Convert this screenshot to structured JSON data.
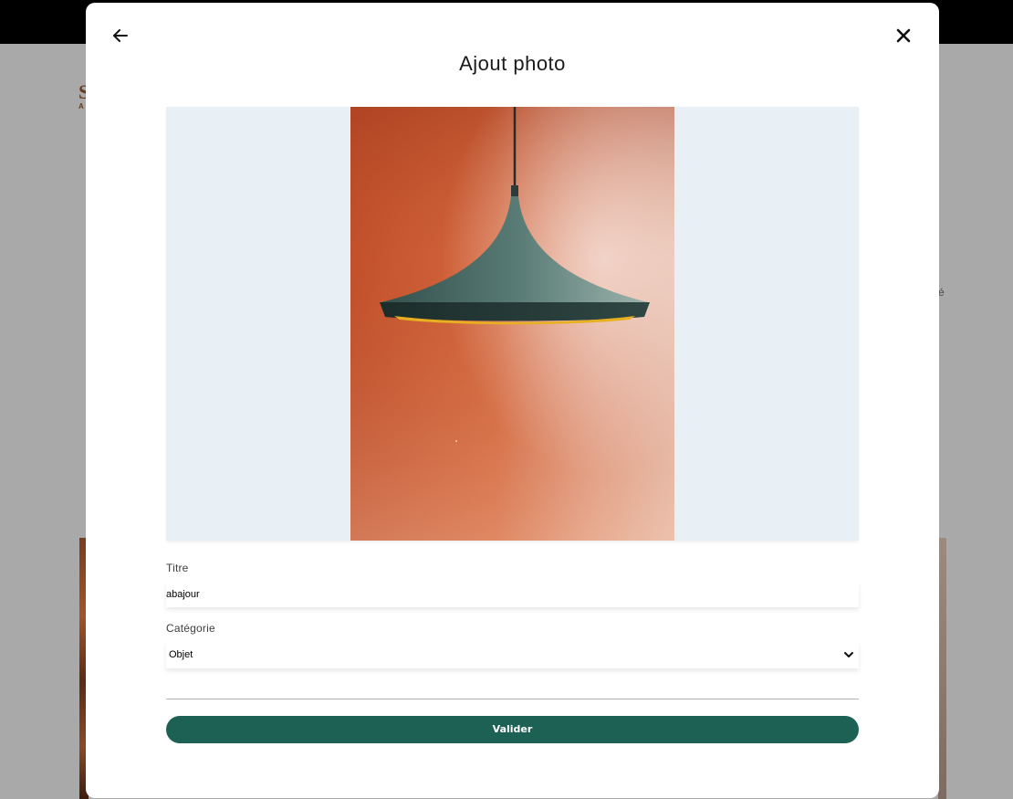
{
  "background": {
    "logo_letter": "S",
    "logo_sub": "A",
    "side_text": "é"
  },
  "modal": {
    "title": "Ajout photo",
    "back_icon": "arrow-left-icon",
    "close_icon": "close-icon",
    "preview": {
      "image_subject": "pendant-lamp-photo",
      "frame_color": "#e8f0f6"
    },
    "form": {
      "title_label": "Titre",
      "title_value": "abajour",
      "category_label": "Catégorie",
      "category_value": "Objet",
      "submit_label": "Valider"
    },
    "colors": {
      "accent": "#1d6154"
    }
  }
}
